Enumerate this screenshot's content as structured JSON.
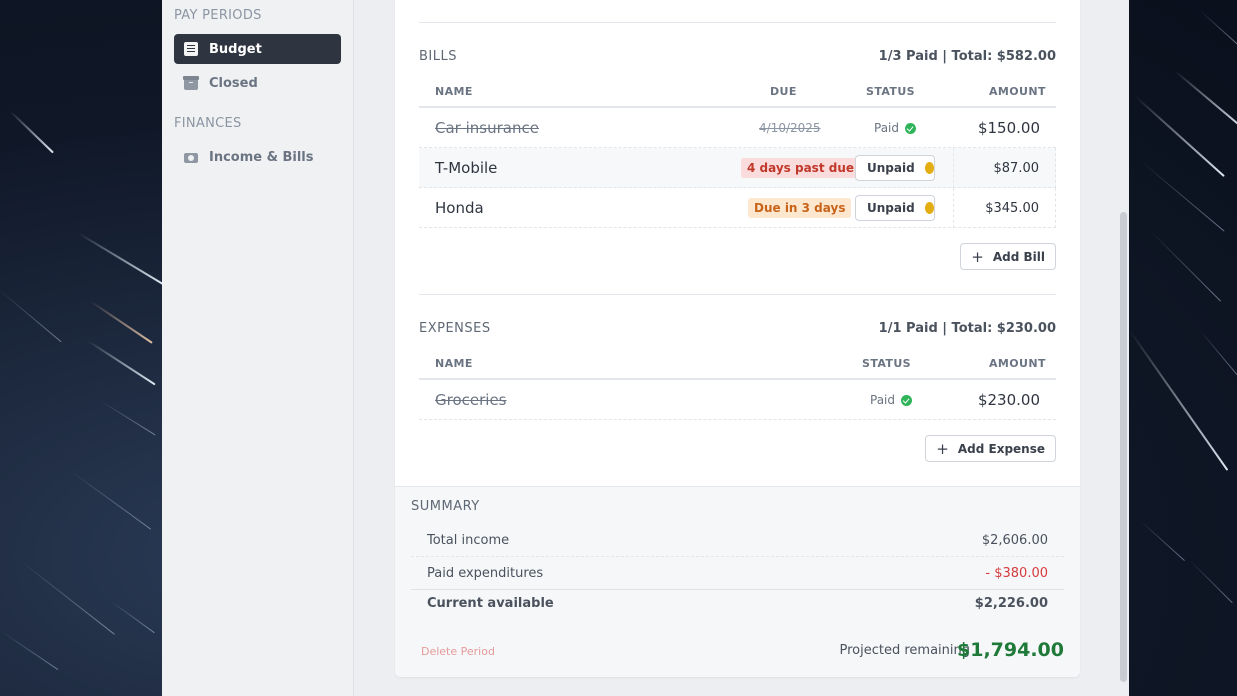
{
  "sidebar": {
    "pay_periods_heading": "PAY PERIODS",
    "pay_periods_items": [
      {
        "label": "Budget",
        "icon": "document-icon",
        "active": true
      },
      {
        "label": "Closed",
        "icon": "archive-icon",
        "active": false
      }
    ],
    "finances_heading": "FINANCES",
    "finances_items": [
      {
        "label": "Income & Bills",
        "icon": "cash-icon",
        "active": false
      }
    ]
  },
  "bills": {
    "title": "BILLS",
    "summary": "1/3 Paid | Total: $582.00",
    "columns": {
      "name": "NAME",
      "due": "DUE",
      "status": "STATUS",
      "amount": "AMOUNT"
    },
    "rows": [
      {
        "name": "Car insurance",
        "due": "4/10/2025",
        "status": "Paid",
        "amount": "$150.00"
      },
      {
        "name": "T-Mobile",
        "due": "4 days past due",
        "status": "Unpaid",
        "amount": "$87.00"
      },
      {
        "name": "Honda",
        "due": "Due in 3 days",
        "status": "Unpaid",
        "amount": "$345.00"
      }
    ],
    "add_label": "Add Bill"
  },
  "expenses": {
    "title": "EXPENSES",
    "summary": "1/1 Paid | Total: $230.00",
    "columns": {
      "name": "NAME",
      "status": "STATUS",
      "amount": "AMOUNT"
    },
    "rows": [
      {
        "name": "Groceries",
        "status": "Paid",
        "amount": "$230.00"
      }
    ],
    "add_label": "Add Expense"
  },
  "summary": {
    "title": "SUMMARY",
    "total_income_label": "Total income",
    "total_income_value": "$2,606.00",
    "paid_exp_label": "Paid expenditures",
    "paid_exp_value": "- $380.00",
    "current_label": "Current available",
    "current_value": "$2,226.00",
    "delete_label": "Delete Period",
    "projected_label": "Projected remaining",
    "projected_value": "$1,794.00"
  },
  "colors": {
    "accent_dark": "#2f3540",
    "paid_green": "#2fb45a",
    "unpaid_yellow": "#e4ad10",
    "negative_red": "#d63c3c",
    "projected_green": "#1f7a3a"
  }
}
